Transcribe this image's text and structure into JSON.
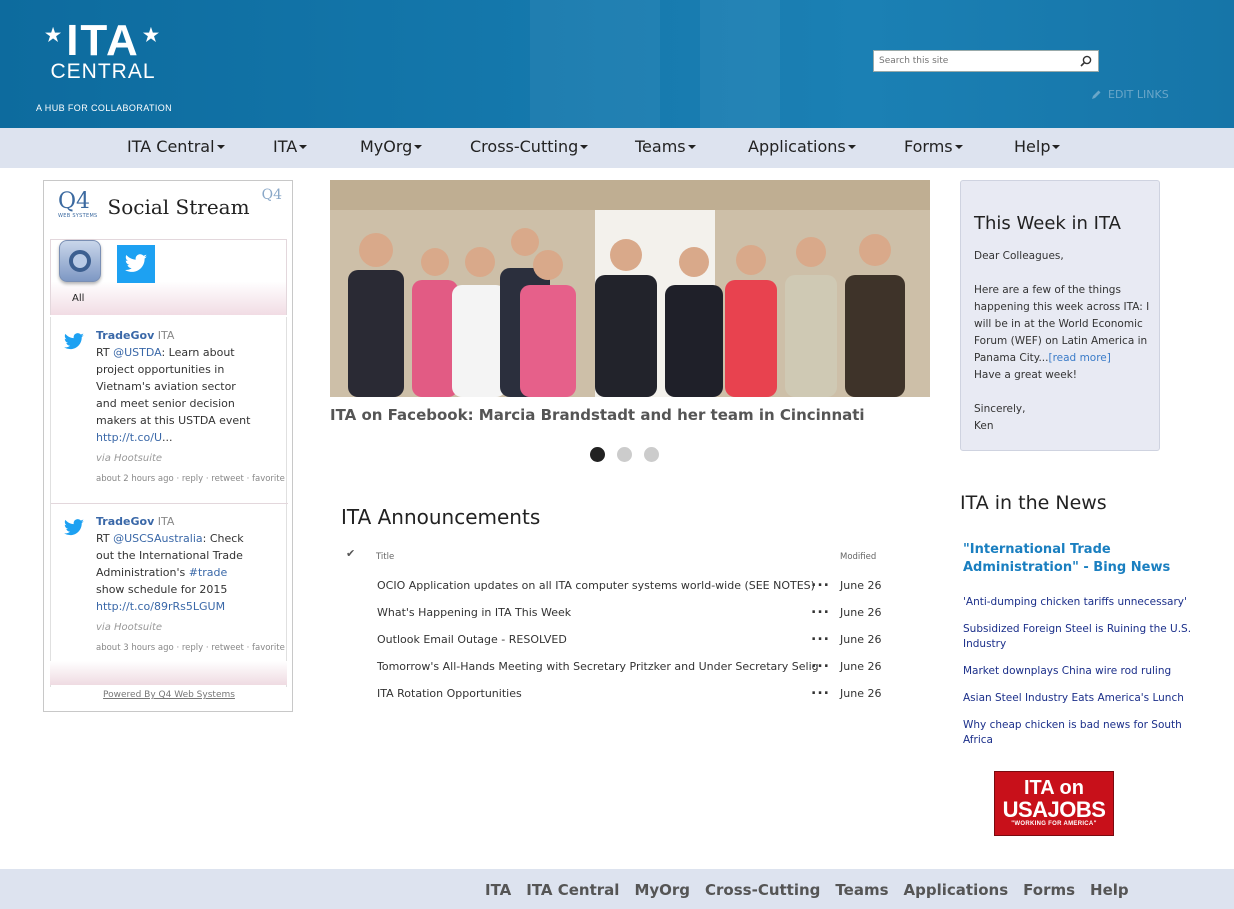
{
  "header": {
    "logo_title": "ITA",
    "logo_subtitle": "CENTRAL",
    "logo_tagline": "A HUB FOR COLLABORATION",
    "search_placeholder": "Search this site",
    "edit_links_label": "EDIT LINKS"
  },
  "nav": {
    "items": [
      "ITA Central",
      "ITA",
      "MyOrg",
      "Cross-Cutting",
      "Teams",
      "Applications",
      "Forms",
      "Help"
    ]
  },
  "social": {
    "logo": "Q4",
    "logo_sub": "WEB SYSTEMS",
    "title": "Social Stream",
    "corner_logo": "Q4",
    "all_label": "All",
    "powered_by": "Powered By Q4 Web Systems",
    "tweets": [
      {
        "author": "TradeGov",
        "handle": "ITA",
        "text_prefix": "RT ",
        "mention": "@USTDA",
        "text": ": Learn about project opportunities in Vietnam's aviation sector and meet senior decision makers at this USTDA event ",
        "link": "http://t.co/U",
        "link_suffix": "...",
        "via": "via Hootsuite",
        "meta": "about 2 hours ago · reply · retweet · favorite"
      },
      {
        "author": "TradeGov",
        "handle": "ITA",
        "text_prefix": "RT ",
        "mention": "@USCSAustralia",
        "text": ": Check out the International Trade Administration's ",
        "hashtag": "#trade",
        "text2": " show schedule for 2015 ",
        "link": "http://t.co/89rRs5LGUM",
        "via": "via Hootsuite",
        "meta": "about 3 hours ago · reply · retweet · favorite"
      }
    ]
  },
  "carousel": {
    "caption": "ITA on Facebook: Marcia Brandstadt and her team in Cincinnati",
    "slide_count": 3,
    "active_slide": 1
  },
  "announcements": {
    "title": "ITA Announcements",
    "col_title": "Title",
    "col_modified": "Modified",
    "rows": [
      {
        "title": "OCIO Application updates on all ITA computer systems world-wide (SEE NOTES)",
        "modified": "June 26"
      },
      {
        "title": "What's Happening in ITA This Week",
        "modified": "June 26"
      },
      {
        "title": "Outlook Email Outage - RESOLVED",
        "modified": "June 26"
      },
      {
        "title": "Tomorrow's All-Hands Meeting with Secretary Pritzker and Under Secretary Selig",
        "modified": "June 26"
      },
      {
        "title": "ITA Rotation Opportunities",
        "modified": "June 26"
      }
    ]
  },
  "this_week": {
    "title": "This Week in ITA",
    "greeting": "Dear Colleagues,",
    "body": "Here are a few of the things happening this week across ITA: I will be in at the World Economic Forum (WEF) on Latin America in Panama City...",
    "read_more": "[read more]",
    "closing": "Have a great week!",
    "signoff": "Sincerely,",
    "name": "Ken"
  },
  "news": {
    "title": "ITA in the News",
    "feed_title": "\"International Trade Administration\" - Bing News",
    "items": [
      "'Anti-dumping chicken tariffs unnecessary'",
      "Subsidized Foreign Steel is Ruining the U.S. Industry",
      "Market downplays China wire rod ruling",
      "Asian Steel Industry Eats America's Lunch",
      "Why cheap chicken is bad news for South Africa"
    ]
  },
  "usajobs": {
    "line1": "ITA on",
    "line2": "USAJOBS",
    "line3": "\"WORKING FOR AMERICA\""
  },
  "footer": {
    "links": [
      "ITA",
      "ITA Central",
      "MyOrg",
      "Cross-Cutting",
      "Teams",
      "Applications",
      "Forms",
      "Help"
    ]
  },
  "colors": {
    "header_blue": "#1477ab",
    "nav_bg": "#dde3ef",
    "link_blue": "#3a68a8",
    "twitter_blue": "#1da1f2"
  }
}
